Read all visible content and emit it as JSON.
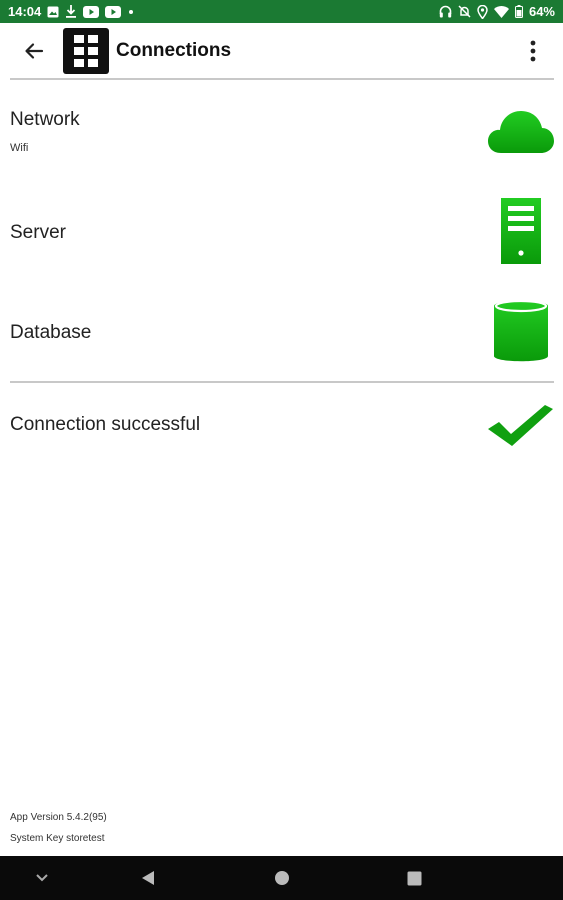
{
  "status_bar": {
    "time": "14:04",
    "battery": "64%",
    "left_icons": [
      "image-icon",
      "download-icon",
      "youtube-icon",
      "youtube-icon",
      "dot-icon"
    ],
    "right_icons": [
      "headphones-icon",
      "bell-off-icon",
      "location-icon",
      "wifi-icon",
      "battery-icon"
    ]
  },
  "app_bar": {
    "title": "Connections",
    "back_icon": "arrow-left-icon",
    "logo_icon": "grid-logo-icon",
    "menu_icon": "more-vert-icon"
  },
  "connections": [
    {
      "label": "Network",
      "sublabel": "Wifi",
      "icon": "cloud-icon",
      "status_color": "#10b010"
    },
    {
      "label": "Server",
      "icon": "server-icon",
      "status_color": "#10b010"
    },
    {
      "label": "Database",
      "icon": "database-icon",
      "status_color": "#10b010"
    }
  ],
  "result": {
    "label": "Connection successful",
    "icon": "check-icon",
    "color": "#10a010"
  },
  "footer": {
    "app_version": "App Version 5.4.2(95)",
    "system_key": "System Key storetest"
  },
  "nav_bar": {
    "buttons": [
      "chevron-down-icon",
      "back-triangle-icon",
      "home-circle-icon",
      "recents-square-icon"
    ]
  },
  "colors": {
    "status_bar": "#1b7a33",
    "accent_green": "#10b010"
  }
}
